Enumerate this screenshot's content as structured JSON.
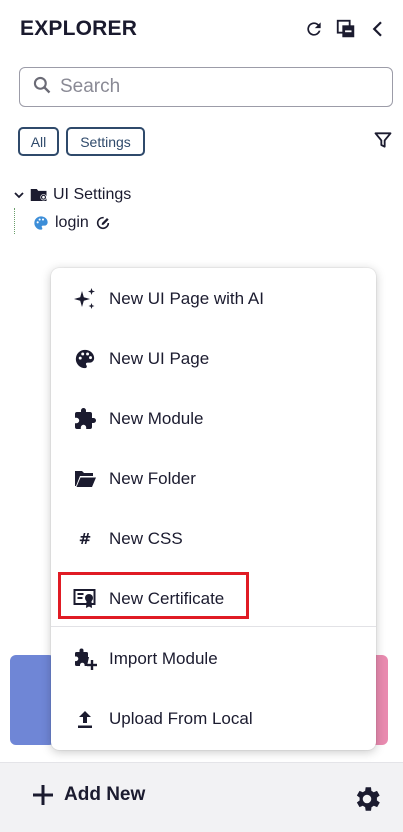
{
  "header": {
    "title": "EXPLORER",
    "icons": [
      "refresh-icon",
      "collapse-all-icon",
      "chevron-left-icon"
    ]
  },
  "search": {
    "placeholder": "Search",
    "value": ""
  },
  "filters": {
    "chips": [
      "All",
      "Settings"
    ],
    "icon": "filter-icon"
  },
  "tree": {
    "folder": {
      "label": "UI Settings",
      "icon": "folder-settings-icon"
    },
    "item": {
      "label": "login",
      "icon": "palette-icon",
      "badge_icon": "edit-circle-icon"
    }
  },
  "context_menu": {
    "items": [
      {
        "label": "New UI Page with AI",
        "icon": "sparkles-icon"
      },
      {
        "label": "New UI Page",
        "icon": "palette-icon"
      },
      {
        "label": "New Module",
        "icon": "puzzle-icon"
      },
      {
        "label": "New Folder",
        "icon": "folder-open-icon"
      },
      {
        "label": "New CSS",
        "icon": "hash-icon"
      },
      {
        "label": "New Certificate",
        "icon": "certificate-icon"
      },
      {
        "label": "Import Module",
        "icon": "puzzle-plus-icon"
      },
      {
        "label": "Upload From Local",
        "icon": "upload-icon"
      }
    ],
    "highlighted": "New Certificate"
  },
  "footer": {
    "add_label": "Add New",
    "settings_icon": "gear-icon"
  },
  "colors": {
    "text": "#1b1b2f",
    "chip_border": "#2f4a6b",
    "highlight": "#e01b24",
    "palette_icon": "#3d8ed8",
    "footer_bg": "#f2f2f4"
  }
}
